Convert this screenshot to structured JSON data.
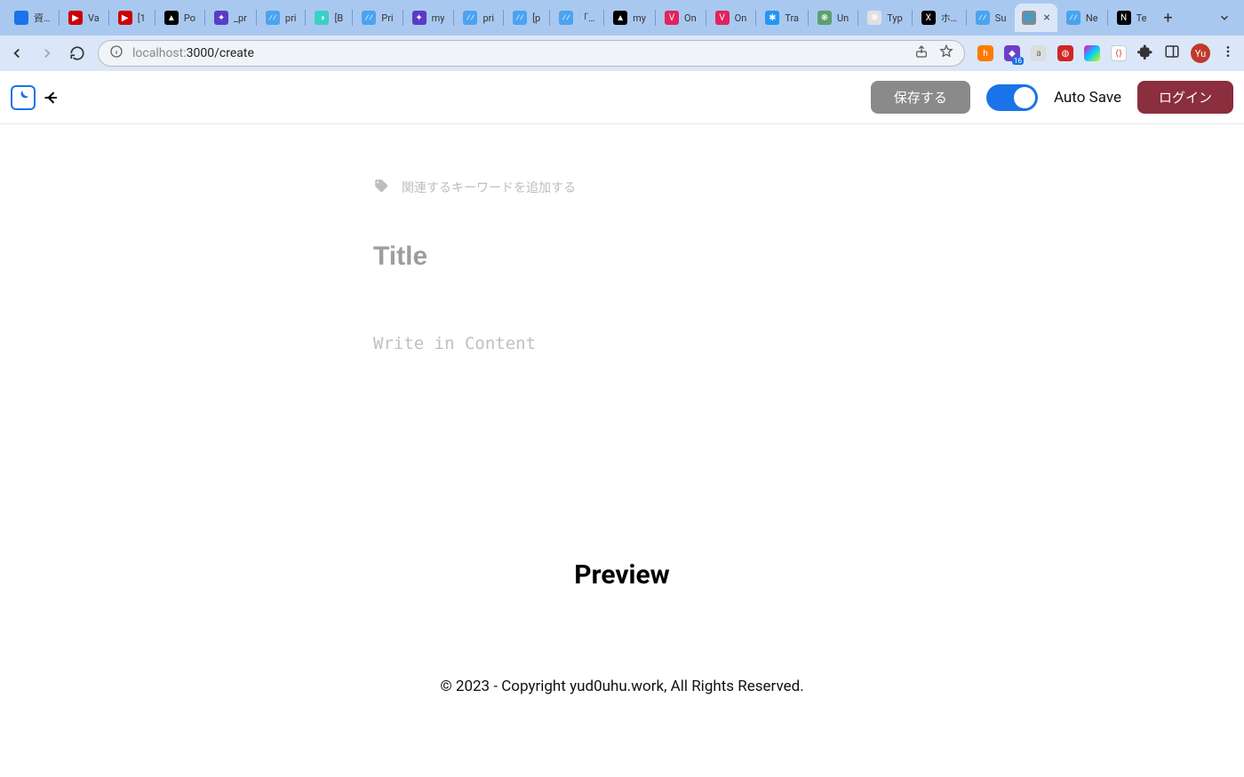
{
  "browser": {
    "tabs": [
      {
        "label": "資料",
        "icon_bg": "#1a73e8",
        "icon_text": ""
      },
      {
        "label": "Va",
        "icon_bg": "#cc0000",
        "icon_text": "▶"
      },
      {
        "label": "[1",
        "icon_bg": "#cc0000",
        "icon_text": "▶"
      },
      {
        "label": "Po",
        "icon_bg": "#000000",
        "icon_text": "▲"
      },
      {
        "label": "_pr",
        "icon_bg": "#5a3cc4",
        "icon_text": "✦"
      },
      {
        "label": "pri",
        "icon_bg": "#4aa3f0",
        "icon_text": "⁄⁄"
      },
      {
        "label": "[B",
        "icon_bg": "#3ad0c3",
        "icon_text": "◑"
      },
      {
        "label": "Pri",
        "icon_bg": "#4aa3f0",
        "icon_text": "⁄⁄"
      },
      {
        "label": "my",
        "icon_bg": "#5a3cc4",
        "icon_text": "✦"
      },
      {
        "label": "pri",
        "icon_bg": "#4aa3f0",
        "icon_text": "⁄⁄"
      },
      {
        "label": "[p",
        "icon_bg": "#4aa3f0",
        "icon_text": "⁄⁄"
      },
      {
        "label": "「耳",
        "icon_bg": "#4aa3f0",
        "icon_text": "⁄⁄"
      },
      {
        "label": "my",
        "icon_bg": "#000000",
        "icon_text": "▲"
      },
      {
        "label": "On",
        "icon_bg": "#e0245e",
        "icon_text": "V"
      },
      {
        "label": "On",
        "icon_bg": "#e0245e",
        "icon_text": "V"
      },
      {
        "label": "Tra",
        "icon_bg": "#2196f3",
        "icon_text": "✱"
      },
      {
        "label": "Un",
        "icon_bg": "#5aa06e",
        "icon_text": "❋"
      },
      {
        "label": "Typ",
        "icon_bg": "#e0e0e0",
        "icon_text": "❋"
      },
      {
        "label": "ホー",
        "icon_bg": "#000000",
        "icon_text": "X"
      },
      {
        "label": "Su",
        "icon_bg": "#4aa3f0",
        "icon_text": "⁄⁄"
      },
      {
        "label": "",
        "icon_bg": "#888888",
        "icon_text": "🌐",
        "active": true,
        "close": "×"
      },
      {
        "label": "Ne",
        "icon_bg": "#4aa3f0",
        "icon_text": "⁄⁄"
      },
      {
        "label": "Te",
        "icon_bg": "#000000",
        "icon_text": "N"
      }
    ],
    "url_host": "localhost:",
    "url_port_path": "3000/create",
    "ext_badge": "16",
    "avatar": "Yu"
  },
  "header": {
    "save_label": "保存する",
    "autosave_label": "Auto Save",
    "login_label": "ログイン"
  },
  "editor": {
    "tag_placeholder": "関連するキーワードを追加する",
    "title_placeholder": "Title",
    "content_placeholder": "Write in Content"
  },
  "preview": {
    "heading": "Preview"
  },
  "footer": {
    "text": "© 2023 - Copyright yud0uhu.work, All Rights Reserved."
  }
}
